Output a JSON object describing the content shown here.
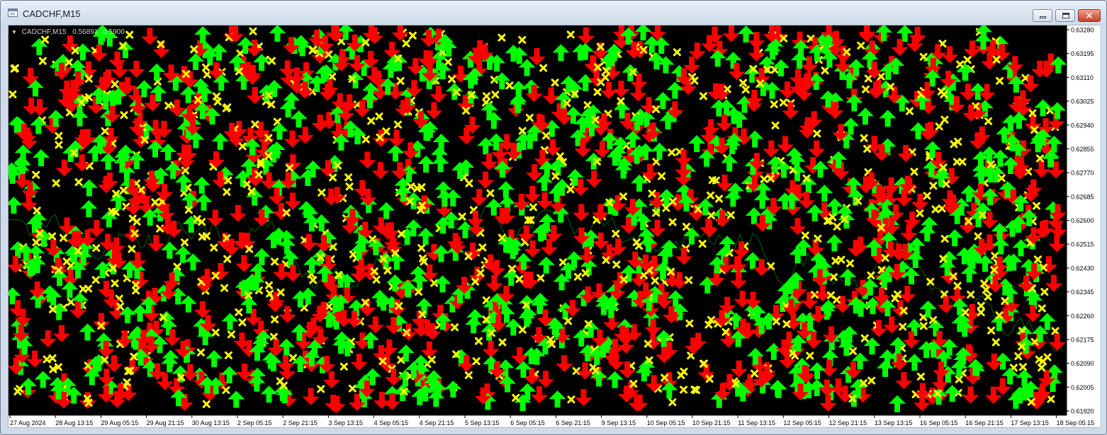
{
  "window": {
    "title": "CADCHF,M15",
    "controls": {
      "minimize": "minimize",
      "restore": "restore",
      "close": "✕"
    }
  },
  "tooltip": {
    "symbol": "CADCHF,M15",
    "values": [
      "0.56891",
      "0.5900"
    ]
  },
  "price_axis": {
    "labels": [
      "0.63280",
      "0.63195",
      "0.63110",
      "0.63025",
      "0.62940",
      "0.62855",
      "0.62770",
      "0.62685",
      "0.62600",
      "0.62515",
      "0.62430",
      "0.62345",
      "0.62260",
      "0.62175",
      "0.62090",
      "0.62005",
      "0.61920"
    ],
    "max": 0.6328,
    "min": 0.6192
  },
  "time_axis": {
    "labels": [
      "27 Aug 2024",
      "28 Aug 13:15",
      "29 Aug 05:15",
      "29 Aug 21:15",
      "30 Aug 13:15",
      "2 Sep 05:15",
      "2 Sep 21:15",
      "3 Sep 13:15",
      "4 Sep 05:15",
      "4 Sep 21:15",
      "5 Sep 13:15",
      "6 Sep 05:15",
      "6 Sep 21:15",
      "9 Sep 13:15",
      "10 Sep 05:15",
      "10 Sep 21:15",
      "11 Sep 13:15",
      "12 Sep 05:15",
      "12 Sep 21:15",
      "13 Sep 13:15",
      "16 Sep 05:15",
      "16 Sep 21:15",
      "17 Sep 13:15",
      "18 Sep 05:15"
    ]
  },
  "colors": {
    "background": "#000000",
    "buy_arrow": "#00ff00",
    "sell_arrow": "#ff0000",
    "cross_marker": "#ffff00",
    "price_line": "#006400",
    "axis_text": "#000000"
  },
  "chart_data": {
    "type": "scatter",
    "title": "",
    "series": [
      {
        "name": "",
        "marker": "up-arrow",
        "color": "#00ff00"
      },
      {
        "name": "",
        "marker": "down-arrow",
        "color": "#ff0000"
      },
      {
        "name": "",
        "marker": "cross",
        "color": "#ffff00"
      }
    ],
    "x_start": "27 Aug 2024",
    "x_end": "18 Sep 05:15",
    "ylim": [
      0.6192,
      0.6328
    ],
    "grid": false,
    "legend": "none"
  }
}
